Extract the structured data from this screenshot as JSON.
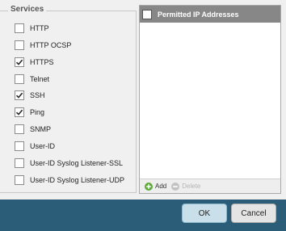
{
  "services": {
    "legend": "Services",
    "items": [
      {
        "label": "HTTP",
        "checked": false
      },
      {
        "label": "HTTP OCSP",
        "checked": false
      },
      {
        "label": "HTTPS",
        "checked": true
      },
      {
        "label": "Telnet",
        "checked": false
      },
      {
        "label": "SSH",
        "checked": true
      },
      {
        "label": "Ping",
        "checked": true
      },
      {
        "label": "SNMP",
        "checked": false
      },
      {
        "label": "User-ID",
        "checked": false
      },
      {
        "label": "User-ID Syslog Listener-SSL",
        "checked": false
      },
      {
        "label": "User-ID Syslog Listener-UDP",
        "checked": false
      }
    ]
  },
  "permitted_ips": {
    "header": "Permitted IP Addresses",
    "add_label": "Add",
    "delete_label": "Delete"
  },
  "buttons": {
    "ok": "OK",
    "cancel": "Cancel"
  },
  "colors": {
    "bottom_bar": "#2b5d79",
    "header_bg": "#878787",
    "add_icon": "#5ea93b",
    "ok_bg": "#c9dfe9"
  }
}
